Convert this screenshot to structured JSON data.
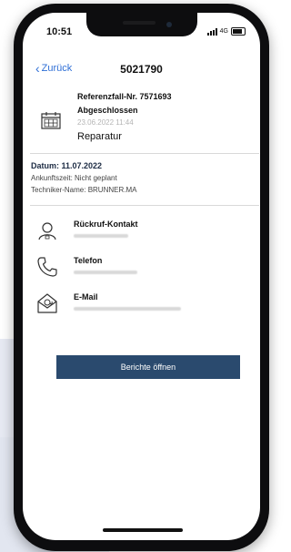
{
  "status_bar": {
    "time": "10:51",
    "network": "4G"
  },
  "nav": {
    "back_label": "Zurück",
    "title": "5021790"
  },
  "case": {
    "reference": "Referenzfall-Nr. 7571693",
    "status": "Abgeschlossen",
    "datetime": "23.06.2022 11:44",
    "type": "Reparatur",
    "icon": "calendar-icon"
  },
  "details": {
    "date": "Datum: 11.07.2022",
    "arrival": "Ankunftszeit: Nicht geplant",
    "technician": "Techniker-Name: BRUNNER.MA"
  },
  "contacts": [
    {
      "label": "Rückruf-Kontakt",
      "icon": "person-icon"
    },
    {
      "label": "Telefon",
      "icon": "phone-icon"
    },
    {
      "label": "E-Mail",
      "icon": "email-icon"
    }
  ],
  "actions": {
    "open_reports_label": "Berichte öffnen"
  },
  "colors": {
    "accent": "#2f6fd6",
    "button": "#2a4a6e",
    "background_panel": "#e7eaf3"
  }
}
